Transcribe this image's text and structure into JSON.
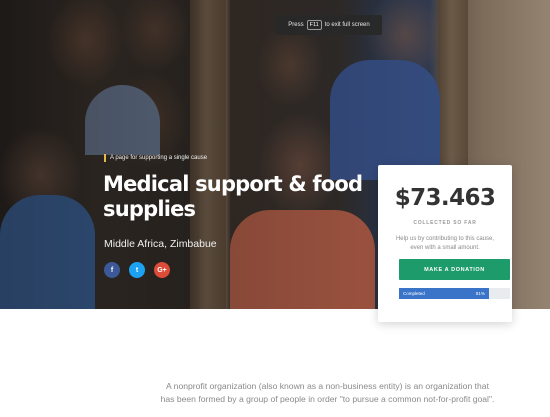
{
  "fullscreen_notice": {
    "press": "Press",
    "key": "F11",
    "suffix": "to exit full screen"
  },
  "hero": {
    "tagline": "A page for supporting a single cause",
    "title": "Medical support & food supplies",
    "location": "Middle Africa, Zimbabue",
    "socials": [
      {
        "icon": "facebook-icon",
        "glyph": "f",
        "color": "#3b5998"
      },
      {
        "icon": "twitter-icon",
        "glyph": "t",
        "color": "#1da1f2"
      },
      {
        "icon": "google-plus-icon",
        "glyph": "G+",
        "color": "#dd4b39"
      }
    ]
  },
  "donation_card": {
    "amount": "$73.463",
    "collected_label": "COLLECTED SO FAR",
    "help_text": "Help us by contributing to this cause, even with a small amount.",
    "button_label": "MAKE A DONATION",
    "progress": {
      "label": "Completed",
      "value_text": "81%",
      "fraction": 0.81
    },
    "accent_color": "#1e9b6a",
    "progress_color": "#3a74c9"
  },
  "about": {
    "text": "A nonprofit organization (also known as a non-business entity) is an organization that has been formed by a group of people in order \"to pursue a common not-for-profit goal\"."
  }
}
